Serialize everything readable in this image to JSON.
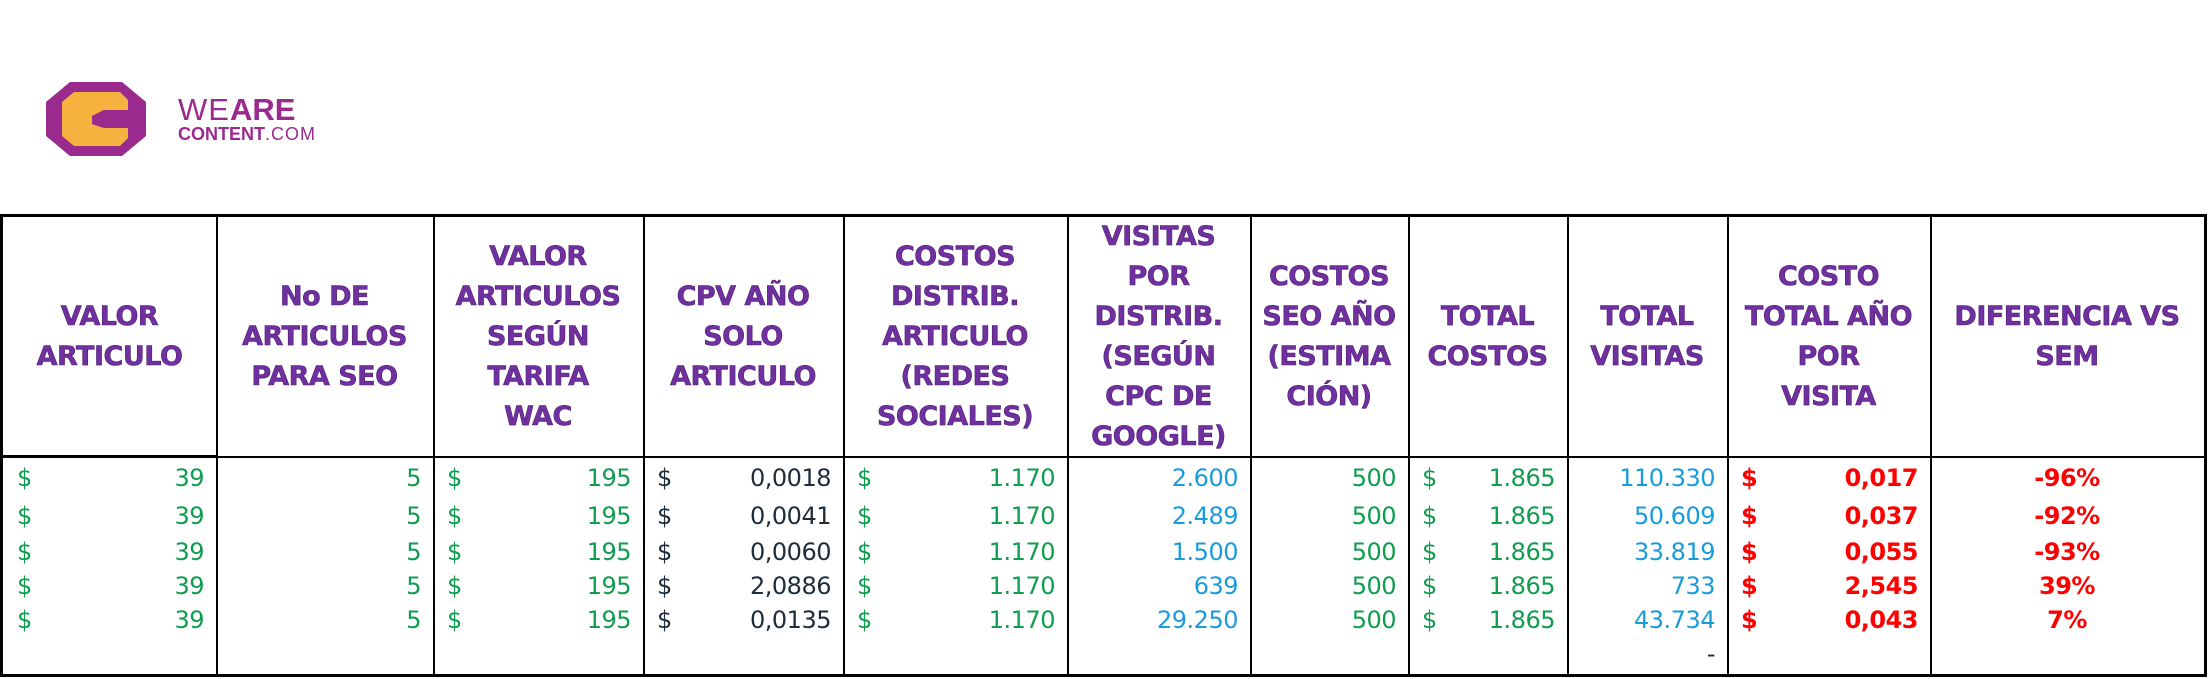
{
  "logo": {
    "line1_thin": "WE",
    "line1_bold": "ARE",
    "line2_bold": "CONTENT",
    "line2_thin": ".COM",
    "colors": {
      "purple": "#9b2a8f",
      "orange": "#f6b23e"
    }
  },
  "table": {
    "headers": [
      "VALOR\nARTICULO",
      "No DE\nARTICULOS\nPARA SEO",
      "VALOR\nARTICULOS\nSEGÚN\nTARIFA\nWAC",
      "CPV AÑO\nSOLO\nARTICULO",
      "COSTOS\nDISTRIB.\nARTICULO\n(REDES\nSOCIALES)",
      "VISITAS\nPOR\nDISTRIB.\n(SEGÚN\nCPC DE\nGOOGLE)",
      "COSTOS\nSEO AÑO\n(ESTIMA\nCIÓN)",
      "TOTAL\nCOSTOS",
      "TOTAL\nVISITAS",
      "COSTO\nTOTAL AÑO\nPOR\nVISITA",
      "DIFERENCIA VS\nSEM"
    ],
    "currency_symbol": "$",
    "rows": [
      {
        "valor_articulo": "39",
        "no_articulos": "5",
        "valor_articulos_wac": "195",
        "cpv": "0,0018",
        "costos_distrib": "1.170",
        "visitas_distrib": "2.600",
        "costos_seo": "500",
        "total_costos": "1.865",
        "total_visitas": "110.330",
        "costo_por_visita": "0,017",
        "diferencia_sem": "-96%"
      },
      {
        "valor_articulo": "39",
        "no_articulos": "5",
        "valor_articulos_wac": "195",
        "cpv": "0,0041",
        "costos_distrib": "1.170",
        "visitas_distrib": "2.489",
        "costos_seo": "500",
        "total_costos": "1.865",
        "total_visitas": "50.609",
        "costo_por_visita": "0,037",
        "diferencia_sem": "-92%"
      },
      {
        "valor_articulo": "39",
        "no_articulos": "5",
        "valor_articulos_wac": "195",
        "cpv": "0,0060",
        "costos_distrib": "1.170",
        "visitas_distrib": "1.500",
        "costos_seo": "500",
        "total_costos": "1.865",
        "total_visitas": "33.819",
        "costo_por_visita": "0,055",
        "diferencia_sem": "-93%"
      },
      {
        "valor_articulo": "39",
        "no_articulos": "5",
        "valor_articulos_wac": "195",
        "cpv": "2,0886",
        "costos_distrib": "1.170",
        "visitas_distrib": "639",
        "costos_seo": "500",
        "total_costos": "1.865",
        "total_visitas": "733",
        "costo_por_visita": "2,545",
        "diferencia_sem": "39%"
      },
      {
        "valor_articulo": "39",
        "no_articulos": "5",
        "valor_articulos_wac": "195",
        "cpv": "0,0135",
        "costos_distrib": "1.170",
        "visitas_distrib": "29.250",
        "costos_seo": "500",
        "total_costos": "1.865",
        "total_visitas": "43.734",
        "costo_por_visita": "0,043",
        "diferencia_sem": "7%"
      }
    ],
    "footer_total_visitas": "-",
    "colors": {
      "header": "#7030a0",
      "green": "#0f9d4f",
      "blue": "#1a9cdc",
      "dark": "#1f2d3a",
      "red": "#ff0000"
    }
  }
}
